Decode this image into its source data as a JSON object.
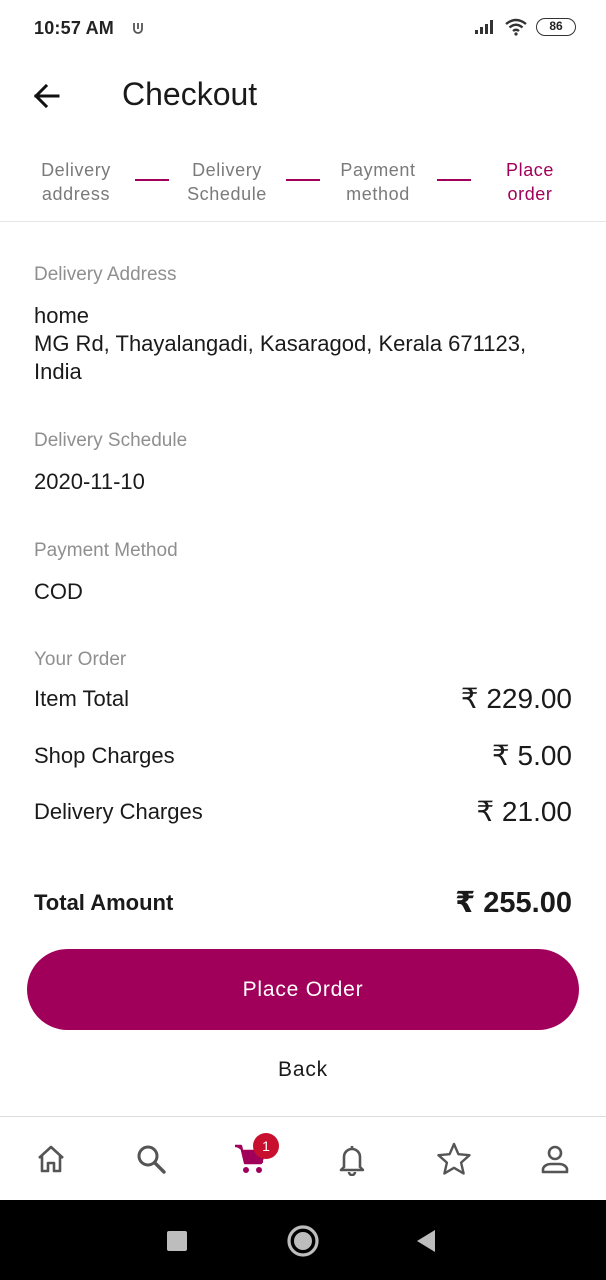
{
  "status_bar": {
    "time": "10:57 AM",
    "battery": "86"
  },
  "header": {
    "title": "Checkout",
    "back_icon": "arrow-left-icon"
  },
  "stepper": {
    "steps": [
      {
        "line1": "Delivery",
        "line2": "address",
        "active": false
      },
      {
        "line1": "Delivery",
        "line2": "Schedule",
        "active": false
      },
      {
        "line1": "Payment",
        "line2": "method",
        "active": false
      },
      {
        "line1": "Place",
        "line2": "order",
        "active": true
      }
    ]
  },
  "address": {
    "label": "Delivery Address",
    "name": "home",
    "line1": "MG Rd, Thayalangadi, Kasaragod, Kerala 671123,",
    "line2": "India"
  },
  "schedule": {
    "label": "Delivery Schedule",
    "value": "2020-11-10"
  },
  "payment": {
    "label": "Payment Method",
    "value": "COD"
  },
  "order": {
    "label": "Your Order",
    "rows": [
      {
        "label": "Item Total",
        "amount": "₹ 229.00"
      },
      {
        "label": "Shop Charges",
        "amount": "₹ 5.00"
      },
      {
        "label": "Delivery Charges",
        "amount": "₹ 21.00"
      }
    ],
    "total_label": "Total Amount",
    "total_amount": "₹ 255.00"
  },
  "actions": {
    "place_order": "Place Order",
    "back": "Back"
  },
  "bottom_nav": {
    "cart_count": "1",
    "items": [
      "home-icon",
      "search-icon",
      "cart-icon",
      "bell-icon",
      "star-icon",
      "profile-icon"
    ]
  },
  "colors": {
    "accent": "#a1005a",
    "badge": "#c8102e"
  }
}
